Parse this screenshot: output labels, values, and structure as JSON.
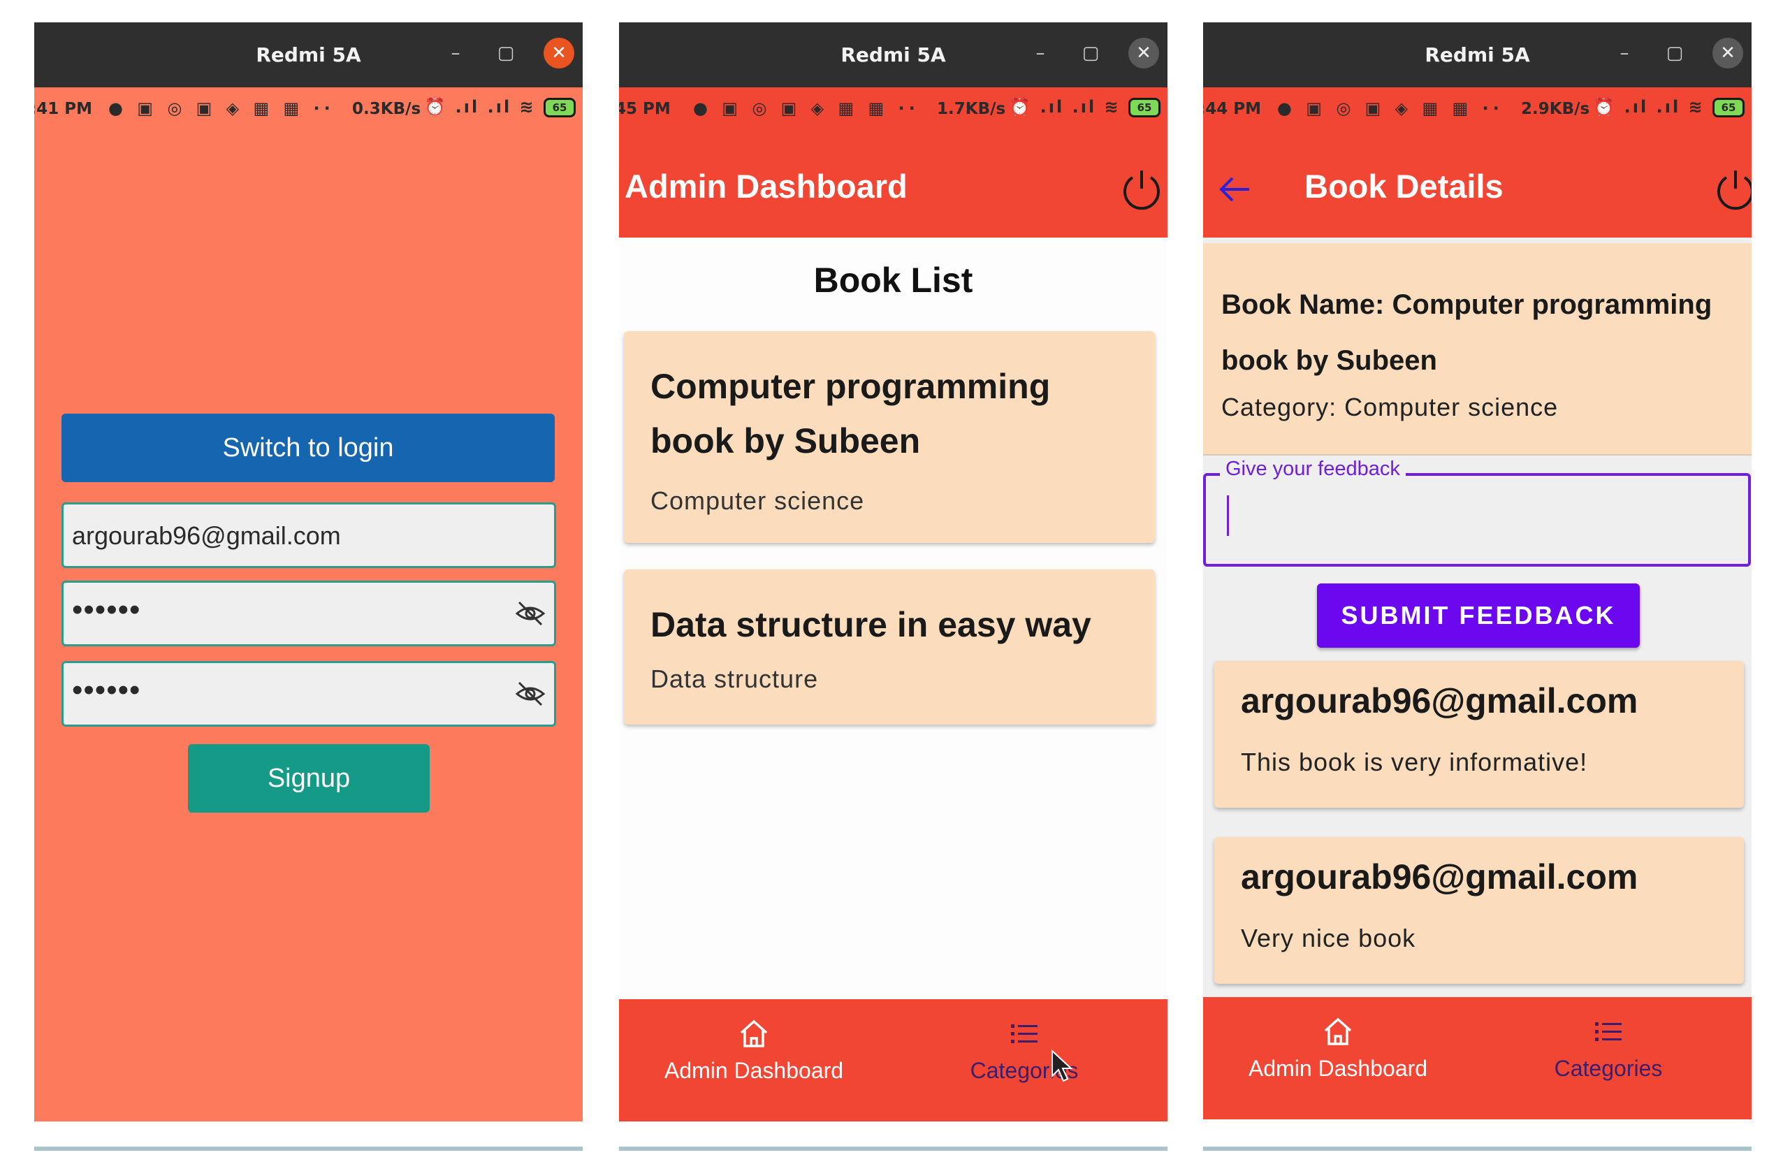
{
  "window": {
    "title": "Redmi 5A",
    "minimize": "–",
    "maximize": "▢",
    "close": "✕"
  },
  "phones": [
    {
      "status": {
        "time": ":41 PM",
        "speed": "0.3KB/s"
      }
    },
    {
      "status": {
        "time": "45 PM",
        "speed": "1.7KB/s"
      }
    },
    {
      "status": {
        "time": ":44 PM",
        "speed": "2.9KB/s"
      }
    }
  ],
  "status_icons": "● ▣ ◎ ▣ ◈ ▦ ▦ ··",
  "status_right": "⏰ .ıl .ıl ≋",
  "battery": "65",
  "signup": {
    "switch_label": "Switch to login",
    "email_value": "argourab96@gmail.com",
    "password_mask": "••••••",
    "confirm_mask": "••••••",
    "signup_label": "Signup",
    "icons": [
      "eye-off-icon"
    ]
  },
  "dashboard": {
    "appbar_title": "Admin Dashboard",
    "list_title": "Book List",
    "books": [
      {
        "name": "Computer programming book by Subeen",
        "name_line1": "Computer programming",
        "name_line2": "book by Subeen",
        "category": "Computer science"
      },
      {
        "name": "Data structure in easy way",
        "category": "Data structure"
      }
    ]
  },
  "details": {
    "appbar_title": "Book Details",
    "book_name_line1": "Book Name: Computer programming",
    "book_name_line2": "book by Subeen",
    "category": "Category: Computer science",
    "feedback_label": "Give your feedback",
    "feedback_value": "",
    "submit_label": "SUBMIT FEEDBACK",
    "feedbacks": [
      {
        "user": "argourab96@gmail.com",
        "text": "This book is very informative!"
      },
      {
        "user": "argourab96@gmail.com",
        "text": "Very nice book"
      }
    ]
  },
  "bottom_nav": {
    "home_label": "Admin Dashboard",
    "categories_label": "Categories"
  },
  "colors": {
    "signup_bg": "#fd7b5c",
    "appbar": "#f14634",
    "switch_button": "#1565b0",
    "signup_button": "#149a86",
    "card": "#fbdcbc",
    "submit_button": "#6c08f0",
    "focus_outline": "#6d1fdc"
  }
}
